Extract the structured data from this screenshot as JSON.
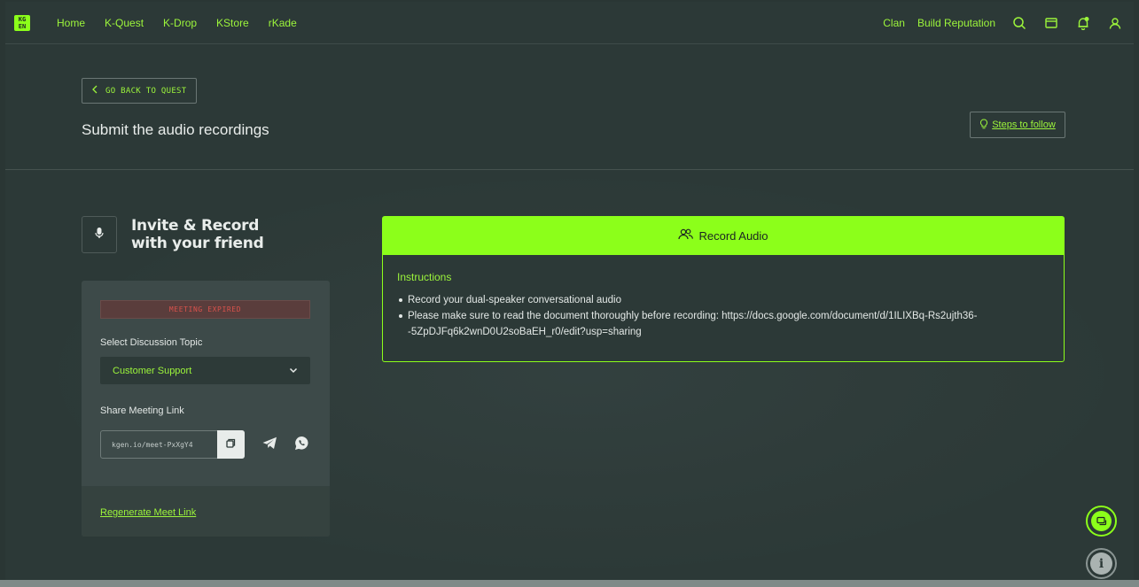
{
  "nav": {
    "logo_text": "KG EN",
    "links": [
      "Home",
      "K-Quest",
      "K-Drop",
      "KStore",
      "rKade"
    ],
    "right_links": [
      "Clan",
      "Build Reputation"
    ],
    "icons": [
      "search-icon",
      "wallet-icon",
      "notification-bell-icon",
      "user-icon"
    ],
    "accent_color": "#8cff1a"
  },
  "header": {
    "back_label": "GO BACK TO QUEST",
    "title": "Submit the audio recordings",
    "steps_label": "Steps to follow"
  },
  "invite": {
    "title_line1": "Invite & Record",
    "title_line2": "with your friend"
  },
  "meeting": {
    "status": "MEETING EXPIRED",
    "topic_label": "Select Discussion Topic",
    "topic_value": "Customer Support",
    "share_label": "Share Meeting Link",
    "link_value": "kgen.io/meet-PxXgY4",
    "regenerate_label": "Regenerate Meet Link"
  },
  "record": {
    "button_label": "Record Audio",
    "instructions_title": "Instructions",
    "instructions": [
      "Record your dual-speaker conversational audio",
      "Please make sure to read the document thoroughly before recording: https://docs.google.com/document/d/1ILIXBq-Rs2ujth36--5ZpDJFq6k2wnD0U2soBaEH_r0/edit?usp=sharing"
    ]
  }
}
